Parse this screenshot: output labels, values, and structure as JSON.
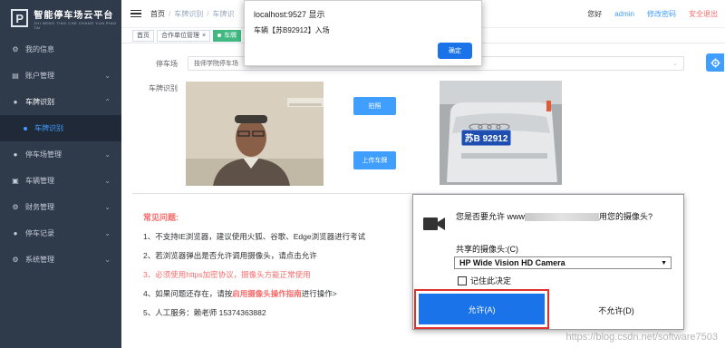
{
  "app": {
    "logo_mark": "P",
    "logo_title": "智能停车场云平台",
    "logo_subtitle": "ZHI NENG TING CHE CHANG YUN PING TAI"
  },
  "sidebar": {
    "items": [
      {
        "label": "我的信息",
        "icon": "user-icon",
        "arrow": ""
      },
      {
        "label": "账户管理",
        "icon": "account-icon",
        "arrow": "⌄"
      },
      {
        "label": "车牌识别",
        "icon": "person-icon",
        "arrow": "⌃"
      },
      {
        "label": "车牌识别",
        "icon": "dot-icon",
        "arrow": ""
      },
      {
        "label": "停车场管理",
        "icon": "person-icon",
        "arrow": "⌄"
      },
      {
        "label": "车辆管理",
        "icon": "card-icon",
        "arrow": "⌄"
      },
      {
        "label": "财务管理",
        "icon": "gear-icon",
        "arrow": "⌄"
      },
      {
        "label": "停车记录",
        "icon": "person-icon",
        "arrow": "⌄"
      },
      {
        "label": "系统管理",
        "icon": "gear-icon",
        "arrow": "⌄"
      }
    ]
  },
  "header": {
    "breadcrumb": [
      "首页",
      "车牌识别",
      "车牌识"
    ],
    "greeting": "您好",
    "username": "admin",
    "change_password": "修改密码",
    "logout": "安全退出"
  },
  "tags": [
    {
      "label": "首页",
      "active": false,
      "closable": false
    },
    {
      "label": "合作单位管理",
      "active": false,
      "closable": true
    },
    {
      "label": "车牌",
      "active": true,
      "closable": false
    }
  ],
  "form": {
    "parking_label": "停车场",
    "parking_value": "技师学院停车场",
    "plate_label": "车牌识别",
    "capture_button": "拍照",
    "upload_button": "上传车牌",
    "plate_number": "苏B 92912"
  },
  "faq": {
    "title": "常见问题:",
    "line1": "1、不支持IE浏览器，建议使用火狐、谷歌、Edge浏览器进行考试",
    "line2": "2、若浏览器弹出是否允许调用摄像头，请点击允许",
    "line3": "3、必须使用https加密协议，摄像头方能正常使用",
    "line4_pre": "4、如果问题还存在，请按",
    "line4_highlight": "启用摄像头操作指南",
    "line4_post": "进行操作>",
    "line5": "5、人工服务：赖老师 15374363882"
  },
  "alert": {
    "title": "localhost:9527 显示",
    "message": "车辆【苏B92912】入场",
    "ok_button": "确定"
  },
  "camera_prompt": {
    "question_pre": "您是否要允许 www",
    "question_post": "用您的摄像头?",
    "camera_label": "共享的摄像头:(C)",
    "camera_value": "HP Wide Vision HD Camera",
    "remember": "记住此决定",
    "allow_button": "允许(A)",
    "deny_button": "不允许(D)"
  },
  "watermark": "https://blog.csdn.net/software7503",
  "colors": {
    "sidebar_bg": "#2f3a4b",
    "primary": "#409eff",
    "danger": "#f56c6c",
    "tag_active": "#42b983",
    "dialog_button": "#1a73e8"
  }
}
